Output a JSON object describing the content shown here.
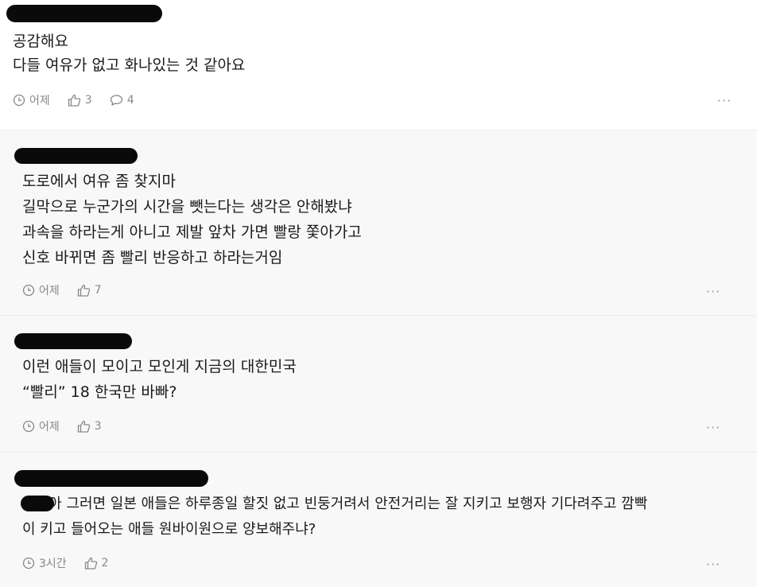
{
  "comments": [
    {
      "lines": [
        "공감해요",
        "다들 여유가 없고 화나있는 것 같아요"
      ],
      "time": "어제",
      "likes": "3",
      "replies": "4",
      "more": "···"
    },
    {
      "lines": [
        "도로에서 여유 좀 찾지마",
        "길막으로 누군가의 시간을 뺏는다는 생각은 안해봤냐",
        "과속을 하라는게 아니고 제발 앞차 가면 빨랑 쫓아가고",
        "신호 바뀌면 좀 빨리 반응하고 하라는거임"
      ],
      "time": "어제",
      "likes": "7",
      "more": "···"
    },
    {
      "lines": [
        "이런 애들이 모이고 모인게 지금의 대한민국",
        "“빨리” 18 한국만 바빠?"
      ],
      "time": "어제",
      "likes": "3",
      "more": "···"
    },
    {
      "lines": [
        "ㅋㅋ아 그러면 일본 애들은 하루종일 할짓 없고 빈둥거려서 안전거리는 잘 지키고 보행자 기다려주고 깜빡",
        "이 키고 들어오는 애들 원바이원으로 양보해주냐?"
      ],
      "time": "3시간",
      "likes": "2",
      "more": "···"
    }
  ]
}
